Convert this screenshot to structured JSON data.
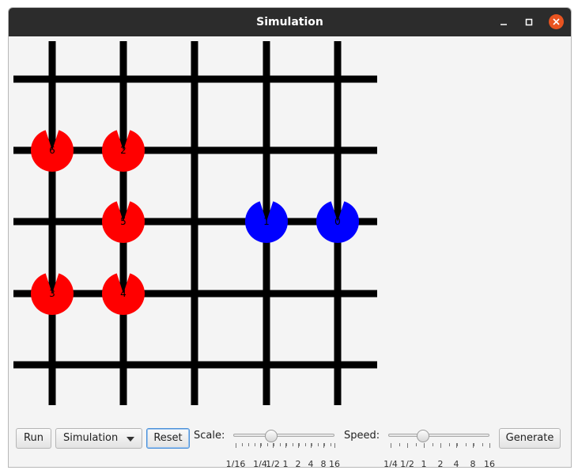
{
  "window": {
    "title": "Simulation",
    "accent_close": "#e95420"
  },
  "grid": {
    "columns": 5,
    "rows": 5,
    "line_color": "#000000",
    "background": "#f4f4f4"
  },
  "agents": [
    {
      "label": "6",
      "col": 0,
      "row": 1,
      "color": "#ff0000",
      "heading": "north"
    },
    {
      "label": "2",
      "col": 1,
      "row": 1,
      "color": "#ff0000",
      "heading": "north"
    },
    {
      "label": "5",
      "col": 1,
      "row": 2,
      "color": "#ff0000",
      "heading": "north"
    },
    {
      "label": "1",
      "col": 3,
      "row": 2,
      "color": "#0000ff",
      "heading": "north"
    },
    {
      "label": "0",
      "col": 4,
      "row": 2,
      "color": "#0000ff",
      "heading": "north"
    },
    {
      "label": "3",
      "col": 0,
      "row": 3,
      "color": "#ff0000",
      "heading": "north"
    },
    {
      "label": "4",
      "col": 1,
      "row": 3,
      "color": "#ff0000",
      "heading": "north"
    }
  ],
  "toolbar": {
    "run_label": "Run",
    "mode_selected": "Simulation",
    "reset_label": "Reset",
    "scale_label": "Scale:",
    "speed_label": "Speed:",
    "generate_label": "Generate",
    "scale_slider": {
      "tick_labels": [
        "1/16",
        "1/4",
        "1/2",
        "1",
        "2",
        "4",
        "8",
        "16"
      ],
      "value": "1/2"
    },
    "speed_slider": {
      "tick_labels": [
        "1/4",
        "1/2",
        "1",
        "2",
        "4",
        "8",
        "16"
      ],
      "value": "1/2"
    }
  }
}
